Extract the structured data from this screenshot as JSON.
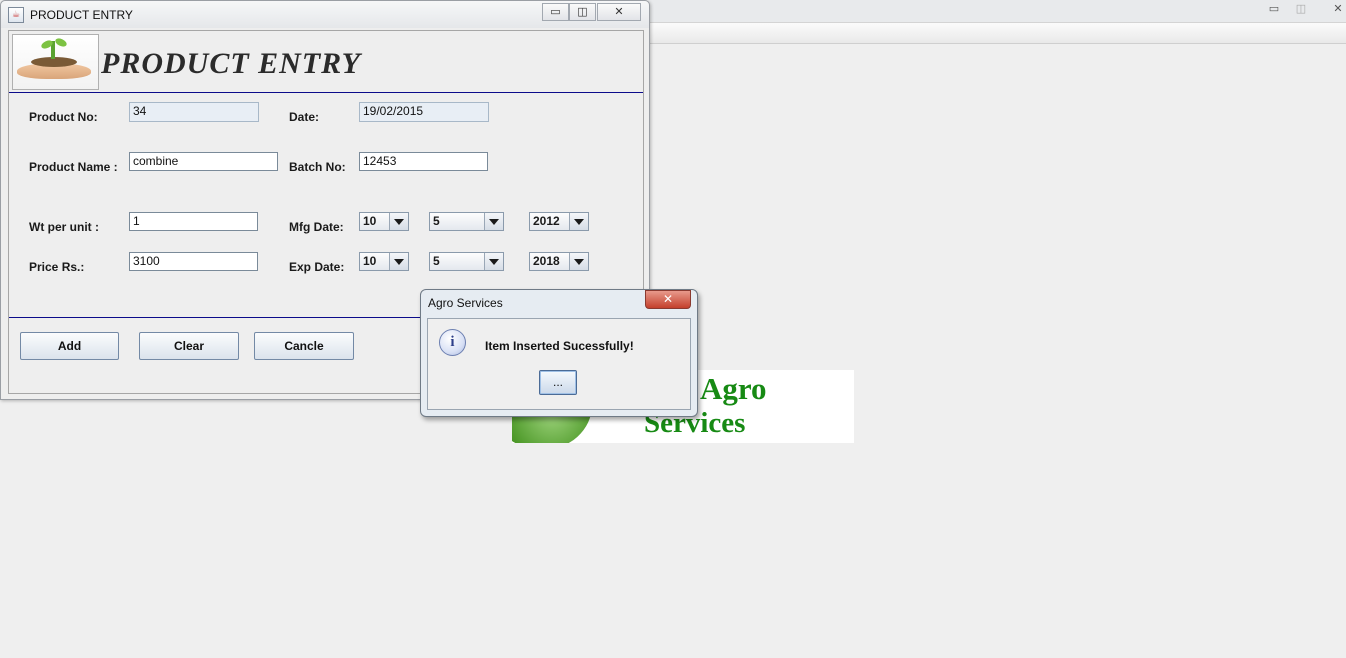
{
  "background_window": {
    "controls": [
      "▭",
      "◫",
      "✕"
    ]
  },
  "logo": {
    "line1": "rsal Agro",
    "line2": "Services"
  },
  "window": {
    "title": "PRODUCT ENTRY",
    "controls": {
      "minimize": "▭",
      "maximize": "◫",
      "close": "✕"
    },
    "java_icon": "☕"
  },
  "form": {
    "heading": "PRODUCT ENTRY",
    "product_no": {
      "label": "Product No:",
      "value": "34"
    },
    "date": {
      "label": "Date:",
      "value": "19/02/2015"
    },
    "product_name": {
      "label": "Product Name :",
      "value": "combine"
    },
    "batch_no": {
      "label": "Batch No:",
      "value": "12453"
    },
    "wt_per_unit": {
      "label": "Wt per unit :",
      "value": "1"
    },
    "price": {
      "label": "Price Rs.:",
      "value": "3100"
    },
    "mfg_date": {
      "label": "Mfg Date:",
      "day": "10",
      "month": "5",
      "year": "2012"
    },
    "exp_date": {
      "label": "Exp Date:",
      "day": "10",
      "month": "5",
      "year": "2018"
    }
  },
  "buttons": {
    "add": "Add",
    "clear": "Clear",
    "cancel": "Cancle"
  },
  "dialog": {
    "title": "Agro Services",
    "close": "✕",
    "icon": "i",
    "message": "Item Inserted Sucessfully!",
    "ok_label": "..."
  },
  "colors": {
    "separator": "#0b0b8a",
    "logo_green": "#178a14",
    "dialog_close": "#c4402c"
  }
}
